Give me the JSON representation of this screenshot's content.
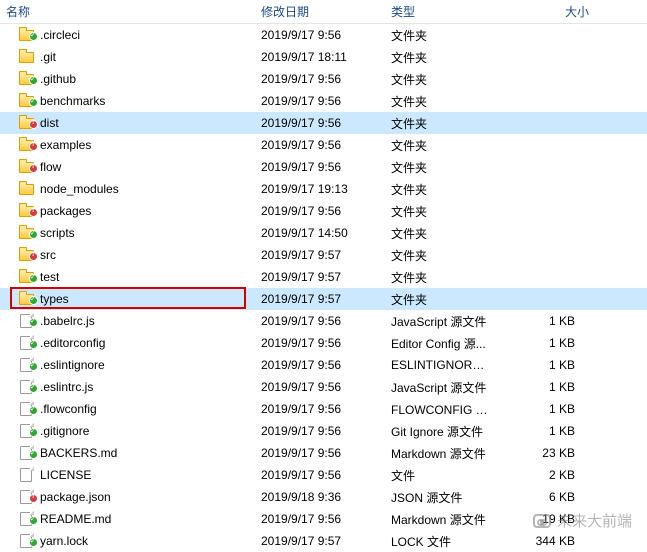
{
  "columns": {
    "name": "名称",
    "date": "修改日期",
    "type": "类型",
    "size": "大小"
  },
  "rows": [
    {
      "icon": "folder",
      "badge": "green",
      "name": ".circleci",
      "date": "2019/9/17 9:56",
      "type": "文件夹",
      "size": ""
    },
    {
      "icon": "folder",
      "badge": "",
      "name": ".git",
      "date": "2019/9/17 18:11",
      "type": "文件夹",
      "size": ""
    },
    {
      "icon": "folder",
      "badge": "green",
      "name": ".github",
      "date": "2019/9/17 9:56",
      "type": "文件夹",
      "size": ""
    },
    {
      "icon": "folder",
      "badge": "green",
      "name": "benchmarks",
      "date": "2019/9/17 9:56",
      "type": "文件夹",
      "size": ""
    },
    {
      "icon": "folder",
      "badge": "red",
      "name": "dist",
      "date": "2019/9/17 9:56",
      "type": "文件夹",
      "size": "",
      "selected": true
    },
    {
      "icon": "folder",
      "badge": "red",
      "name": "examples",
      "date": "2019/9/17 9:56",
      "type": "文件夹",
      "size": ""
    },
    {
      "icon": "folder",
      "badge": "red",
      "name": "flow",
      "date": "2019/9/17 9:56",
      "type": "文件夹",
      "size": ""
    },
    {
      "icon": "folder",
      "badge": "",
      "name": "node_modules",
      "date": "2019/9/17 19:13",
      "type": "文件夹",
      "size": ""
    },
    {
      "icon": "folder",
      "badge": "red",
      "name": "packages",
      "date": "2019/9/17 9:56",
      "type": "文件夹",
      "size": ""
    },
    {
      "icon": "folder",
      "badge": "green",
      "name": "scripts",
      "date": "2019/9/17 14:50",
      "type": "文件夹",
      "size": ""
    },
    {
      "icon": "folder",
      "badge": "red",
      "name": "src",
      "date": "2019/9/17 9:57",
      "type": "文件夹",
      "size": ""
    },
    {
      "icon": "folder",
      "badge": "green",
      "name": "test",
      "date": "2019/9/17 9:57",
      "type": "文件夹",
      "size": ""
    },
    {
      "icon": "folder",
      "badge": "green",
      "name": "types",
      "date": "2019/9/17 9:57",
      "type": "文件夹",
      "size": "",
      "selected": true,
      "highlight": true
    },
    {
      "icon": "file",
      "badge": "green",
      "name": ".babelrc.js",
      "date": "2019/9/17 9:56",
      "type": "JavaScript 源文件",
      "size": "1 KB"
    },
    {
      "icon": "file",
      "badge": "green",
      "name": ".editorconfig",
      "date": "2019/9/17 9:56",
      "type": "Editor Config 源...",
      "size": "1 KB"
    },
    {
      "icon": "file",
      "badge": "green",
      "name": ".eslintignore",
      "date": "2019/9/17 9:56",
      "type": "ESLINTIGNORE ...",
      "size": "1 KB"
    },
    {
      "icon": "file",
      "badge": "green",
      "name": ".eslintrc.js",
      "date": "2019/9/17 9:56",
      "type": "JavaScript 源文件",
      "size": "1 KB"
    },
    {
      "icon": "file",
      "badge": "green",
      "name": ".flowconfig",
      "date": "2019/9/17 9:56",
      "type": "FLOWCONFIG 文...",
      "size": "1 KB"
    },
    {
      "icon": "file",
      "badge": "green",
      "name": ".gitignore",
      "date": "2019/9/17 9:56",
      "type": "Git Ignore 源文件",
      "size": "1 KB"
    },
    {
      "icon": "file",
      "badge": "green",
      "name": "BACKERS.md",
      "date": "2019/9/17 9:56",
      "type": "Markdown 源文件",
      "size": "23 KB"
    },
    {
      "icon": "file",
      "badge": "",
      "name": "LICENSE",
      "date": "2019/9/17 9:56",
      "type": "文件",
      "size": "2 KB"
    },
    {
      "icon": "file",
      "badge": "red",
      "name": "package.json",
      "date": "2019/9/18 9:36",
      "type": "JSON 源文件",
      "size": "6 KB"
    },
    {
      "icon": "file",
      "badge": "green",
      "name": "README.md",
      "date": "2019/9/17 9:56",
      "type": "Markdown 源文件",
      "size": "19 KB"
    },
    {
      "icon": "file",
      "badge": "green",
      "name": "yarn.lock",
      "date": "2019/9/17 9:57",
      "type": "LOCK 文件",
      "size": "344 KB"
    }
  ],
  "watermark": "未来大前端"
}
